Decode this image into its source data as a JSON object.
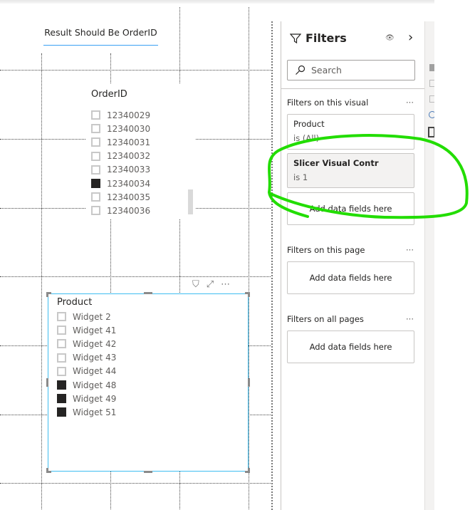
{
  "canvas": {
    "title_text": "Result Should Be OrderID",
    "orderid_slicer": {
      "header": "OrderID",
      "items": [
        {
          "label": "12340029",
          "checked": false
        },
        {
          "label": "12340030",
          "checked": false
        },
        {
          "label": "12340031",
          "checked": false
        },
        {
          "label": "12340032",
          "checked": false
        },
        {
          "label": "12340033",
          "checked": false
        },
        {
          "label": "12340034",
          "checked": true
        },
        {
          "label": "12340035",
          "checked": false
        },
        {
          "label": "12340036",
          "checked": false
        }
      ]
    },
    "product_slicer": {
      "header": "Product",
      "items": [
        {
          "label": "Widget 2",
          "checked": false
        },
        {
          "label": "Widget 41",
          "checked": false
        },
        {
          "label": "Widget 42",
          "checked": false
        },
        {
          "label": "Widget 43",
          "checked": false
        },
        {
          "label": "Widget 44",
          "checked": false
        },
        {
          "label": "Widget 48",
          "checked": true
        },
        {
          "label": "Widget 49",
          "checked": true
        },
        {
          "label": "Widget 51",
          "checked": true
        }
      ],
      "toolbar": {
        "filter": "⛉",
        "focus": "⤢",
        "more": "⋯"
      }
    }
  },
  "filters": {
    "title": "Filters",
    "eye_icon": "👁",
    "collapse_icon": "›",
    "search_placeholder": "Search",
    "visual_section": "Filters on this visual",
    "more": "···",
    "cards": [
      {
        "field": "Product",
        "state": "is (All)"
      },
      {
        "field": "Slicer Visual Contr",
        "state": "is 1"
      }
    ],
    "add_fields": "Add data fields here",
    "page_section": "Filters on this page",
    "all_section": "Filters on all pages"
  },
  "colors": {
    "accent": "#3ebdf0",
    "annotation": "#22dd00",
    "checked": "#252423"
  }
}
